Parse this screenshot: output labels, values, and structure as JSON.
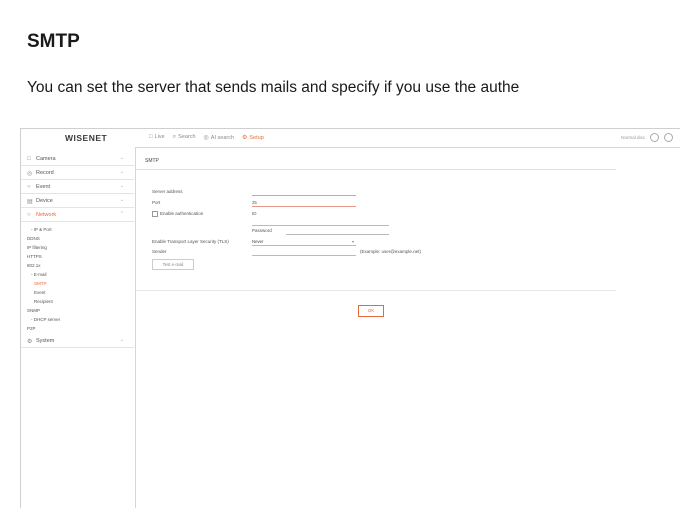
{
  "doc": {
    "title": "SMTP",
    "description": "You can set the server that sends mails and specify if you use the authe"
  },
  "app": {
    "logo": "WISENET",
    "nav": [
      {
        "icon": "□",
        "label": "Live"
      },
      {
        "icon": "⌕",
        "label": "Search"
      },
      {
        "icon": "◎",
        "label": "AI search"
      },
      {
        "icon": "⚙",
        "label": "Setup"
      }
    ],
    "user": "Normal disc"
  },
  "sidebar": {
    "menus": [
      {
        "icon": "□",
        "label": "Camera"
      },
      {
        "icon": "◎",
        "label": "Record"
      },
      {
        "icon": "○",
        "label": "Event"
      },
      {
        "icon": "▤",
        "label": "Device"
      },
      {
        "icon": "○",
        "label": "Network"
      },
      {
        "icon": "⚙",
        "label": "System"
      }
    ],
    "network_sub": [
      "- IP & Port",
      "DDNS",
      "IP filtering",
      "HTTPS",
      "802.1x",
      "- E-mail",
      "SMTP",
      "Event",
      "Recipient",
      "SNMP",
      "- DHCP server",
      "P2P"
    ]
  },
  "form": {
    "section_title": "SMTP",
    "server_address_label": "Server address",
    "port_label": "Port",
    "port_value": "25",
    "enable_auth_label": "Enable authentication",
    "id_label": "ID",
    "password_label": "Password",
    "tls_label": "Enable Transport Layer Security (TLS)",
    "tls_value": "Never",
    "sender_label": "Sender",
    "sender_example": "(Example: user@example.net)",
    "test_button": "Test e-mail",
    "ok_button": "OK"
  }
}
